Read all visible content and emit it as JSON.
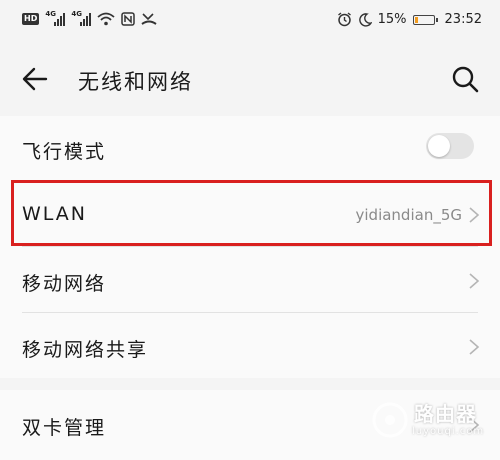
{
  "status_bar": {
    "hd_label": "HD",
    "signal1_tag": "4G",
    "signal2_tag": "4G",
    "battery_percent": "15%",
    "battery_level": 0.15,
    "battery_color": "#f29c1f",
    "time": "23:52",
    "icons": [
      "wifi-icon",
      "nfc-icon",
      "missed-call-icon",
      "alarm-icon",
      "moon-icon",
      "battery-icon"
    ]
  },
  "header": {
    "title": "无线和网络",
    "back_icon": "arrow-left-icon",
    "search_icon": "search-icon"
  },
  "settings": [
    {
      "label": "飞行模式",
      "control": "toggle",
      "on": false
    },
    {
      "label": "WLAN",
      "value": "yidiandian_5G",
      "control": "chevron"
    },
    {
      "label": "移动网络",
      "control": "chevron"
    },
    {
      "label": "移动网络共享",
      "control": "chevron"
    }
  ],
  "settings2": [
    {
      "label": "双卡管理",
      "control": "chevron"
    }
  ],
  "watermark": {
    "text": "路由器",
    "sub": "luyouqi.com"
  },
  "colors": {
    "highlight": "#d9201f",
    "background": "#f4f4f4",
    "card": "#fafafa",
    "secondary_text": "#8a8a8a"
  }
}
